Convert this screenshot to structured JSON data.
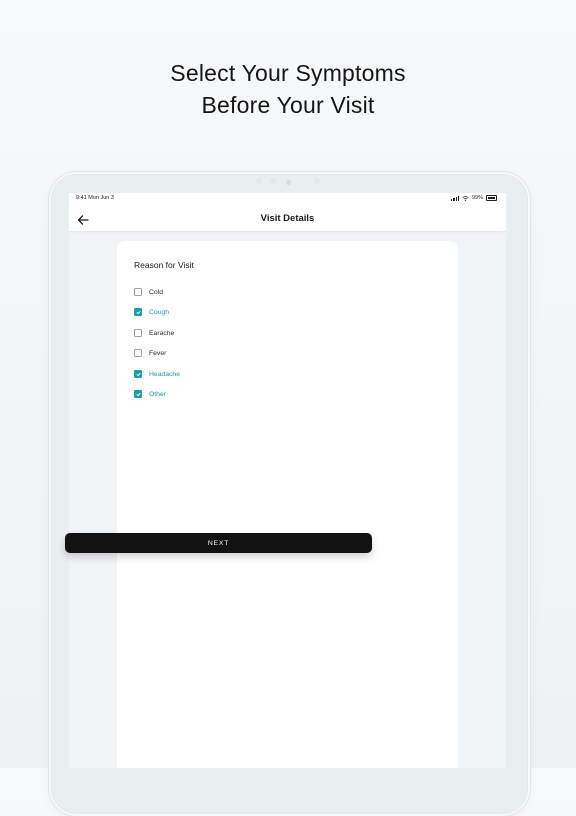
{
  "headline": {
    "line1": "Select Your Symptoms",
    "line2": "Before Your Visit"
  },
  "status_bar": {
    "time_date": "9:41  Mon Jun 3",
    "battery": "99%"
  },
  "nav": {
    "back_icon": "arrow-left-icon",
    "title": "Visit Details"
  },
  "form": {
    "section_title": "Reason for Visit",
    "options": [
      {
        "label": "Cold",
        "checked": false
      },
      {
        "label": "Cough",
        "checked": true
      },
      {
        "label": "Earache",
        "checked": false
      },
      {
        "label": "Fever",
        "checked": false
      },
      {
        "label": "Headache",
        "checked": true
      },
      {
        "label": "Other",
        "checked": true
      }
    ]
  },
  "next_button": {
    "label": "NEXT"
  },
  "colors": {
    "accent": "#1a9ea8",
    "button": "#121212",
    "background": "#f0f4f6"
  }
}
